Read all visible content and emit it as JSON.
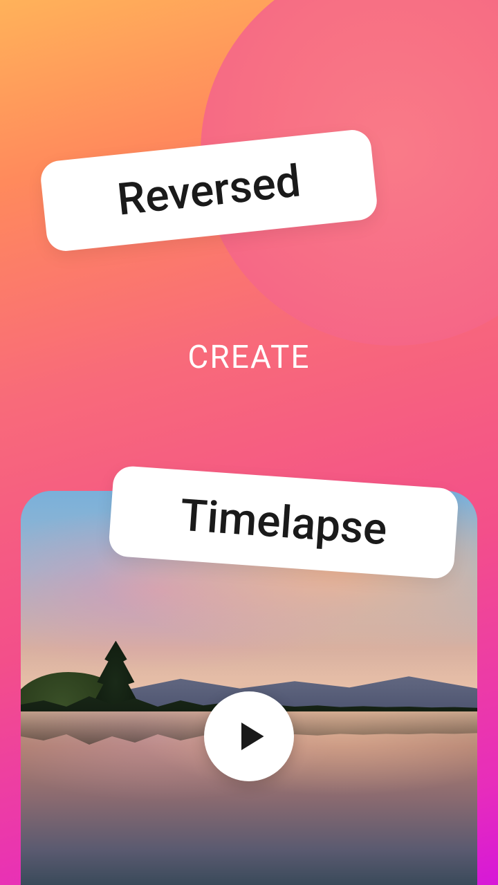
{
  "labels": {
    "reversed": "Reversed",
    "create": "CREATE",
    "timelapse": "Timelapse"
  },
  "icons": {
    "play": "play-icon"
  },
  "colors": {
    "gradient_top": "#ffb25a",
    "gradient_bottom": "#d618d8",
    "pill_bg": "#ffffff",
    "pill_text": "#1a1a1a",
    "create_text": "#ffffff"
  }
}
